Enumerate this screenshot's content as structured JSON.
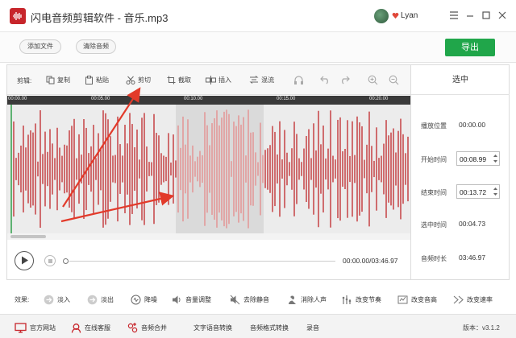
{
  "window": {
    "title": "闪电音频剪辑软件 - 音乐.mp3",
    "username": "Lyan"
  },
  "toolbar": {
    "add_file": "添加文件",
    "clear_audio": "清除音频",
    "export": "导出"
  },
  "edit_toolbar": {
    "label": "剪辑:",
    "copy": "复制",
    "paste": "粘贴",
    "cut": "剪切",
    "crop": "截取",
    "insert": "插入",
    "mix": "混流"
  },
  "timeline": {
    "ticks": [
      "00:00.00",
      "00:05.00",
      "00:10.00",
      "00:15.00",
      "00:20.00"
    ]
  },
  "player": {
    "time": "00:00.00/03:46.97",
    "progress": 0
  },
  "side_panel": {
    "title": "选中",
    "play_position_label": "播放位置",
    "play_position_value": "00:00.00",
    "start_time_label": "开始时间",
    "start_time_value": "00:08.99",
    "end_time_label": "结束时间",
    "end_time_value": "00:13.72",
    "selected_duration_label": "选中时间",
    "selected_duration_value": "00:04.73",
    "audio_length_label": "音频时长",
    "audio_length_value": "03:46.97"
  },
  "effects": {
    "label": "效果:",
    "items": [
      "淡入",
      "淡出",
      "降噪",
      "音量调整",
      "去除静音",
      "消除人声",
      "改变节奏",
      "改变音高",
      "改变速率"
    ]
  },
  "bottom_bar": {
    "website": "官方网站",
    "support": "在线客服",
    "merge": "音频合并",
    "tts": "文字语音转换",
    "convert": "音频格式转换",
    "record": "录音",
    "version": "版本：v3.1.2"
  },
  "colors": {
    "brand_red": "#c7252b",
    "export_green": "#20a64a",
    "waveform": "#c0282b",
    "waveform_selected": "#e58b8b"
  }
}
